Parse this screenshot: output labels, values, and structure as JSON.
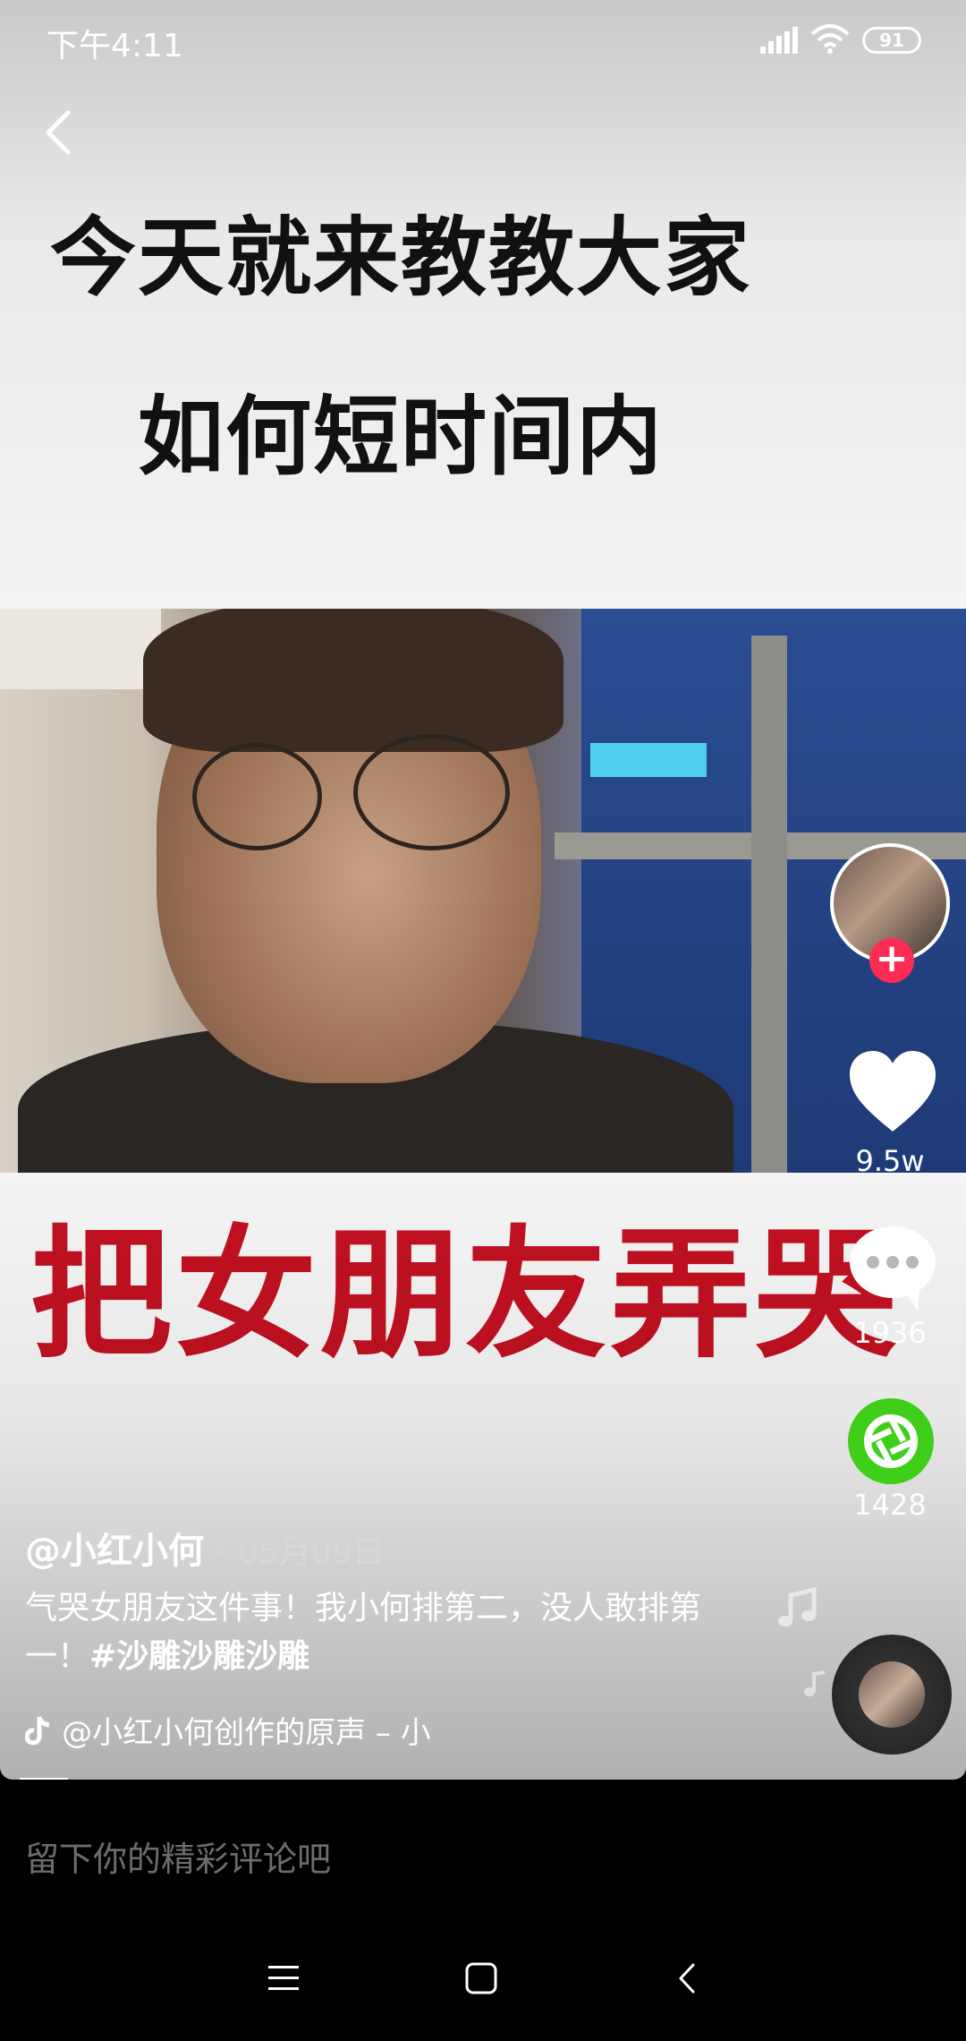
{
  "status_bar": {
    "time": "下午4:11",
    "battery_level": "91",
    "icons": [
      "signal-icon",
      "wifi-icon",
      "battery-icon"
    ]
  },
  "video": {
    "caption_line_1": "今天就来教教大家",
    "caption_line_2": "如何短时间内",
    "caption_red": "把女朋友弄哭"
  },
  "actions": {
    "like_count": "9.5w",
    "comment_count": "1936",
    "share_count": "1428"
  },
  "post": {
    "author": "@小红小何",
    "date": "· 05月09日",
    "description": "气哭女朋友这件事！我小何排第二，没人敢排第一！",
    "hashtag": "#沙雕沙雕沙雕",
    "music": "@小红小何创作的原声 – 小"
  },
  "comment_box": {
    "placeholder": "留下你的精彩评论吧"
  },
  "colors": {
    "like_follow_red": "#fe2c55",
    "share_green": "#3fcf1a",
    "caption_red": "#c01020"
  }
}
